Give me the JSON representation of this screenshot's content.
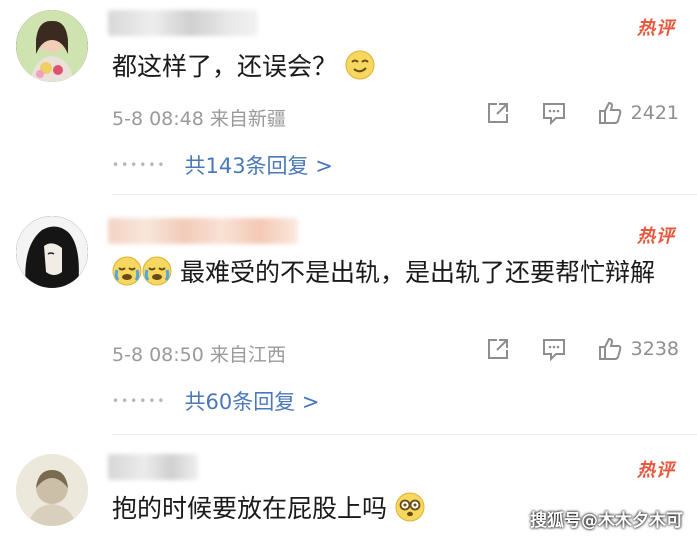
{
  "comments": [
    {
      "badge": "热评",
      "text": "都这样了，还误会？",
      "emoji": "smirk-face-icon",
      "meta": "5-8 08:48 来自新疆",
      "likes": "2421",
      "replies": "共143条回复 >"
    },
    {
      "badge": "热评",
      "text": "最难受的不是出轨，是出轨了还要帮忙辩解",
      "emoji": "crying-face-icon",
      "meta": "5-8 08:50 来自江西",
      "likes": "3238",
      "replies": "共60条回复 >"
    },
    {
      "badge": "热评",
      "text": "抱的时候要放在屁股上吗",
      "emoji": "shocked-glasses-face-icon"
    }
  ],
  "watermark": "搜狐号@木木夕木可",
  "colors": {
    "hot": "#e8583e",
    "link": "#4a78b8",
    "meta": "#9a9a9a"
  }
}
